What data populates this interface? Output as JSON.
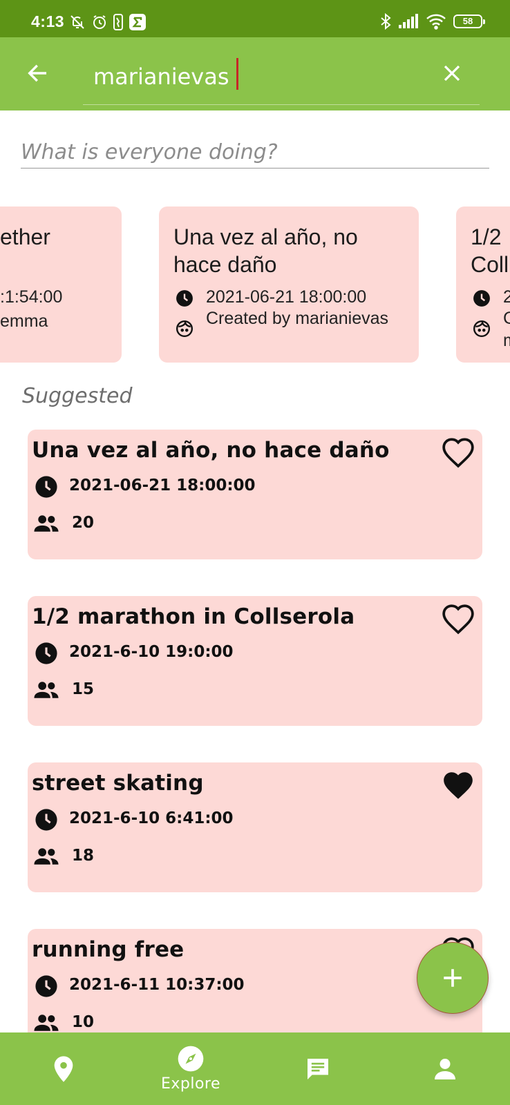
{
  "status_bar": {
    "time": "4:13",
    "battery_level": "58",
    "left_icons": [
      "mute-icon",
      "alarm-icon",
      "nba-icon",
      "sigma-icon"
    ],
    "right_icons": [
      "bluetooth-icon",
      "signal-icon",
      "wifi-icon",
      "battery-icon"
    ]
  },
  "app_bar": {
    "search_value": "marianievas",
    "back_icon": "back-arrow-icon",
    "clear_icon": "close-icon",
    "color": "#8bc34a"
  },
  "activity_search": {
    "placeholder": "What is everyone doing?"
  },
  "carousel": {
    "cards": [
      {
        "title": "ether",
        "time": ":1:54:00",
        "creator": "emma"
      },
      {
        "title": "Una vez al año, no hace daño",
        "time": "2021-06-21 18:00:00",
        "creator": "Created by marianievas"
      },
      {
        "title": "1/2 Coll",
        "time": "2",
        "creator": "C m"
      }
    ]
  },
  "suggested": {
    "label": "Suggested",
    "items": [
      {
        "title": "Una vez al año, no hace daño",
        "time": "2021-06-21 18:00:00",
        "participants": "20",
        "favorite": false
      },
      {
        "title": "1/2 marathon in Collserola",
        "time": "2021-6-10 19:0:00",
        "participants": "15",
        "favorite": false
      },
      {
        "title": "street skating",
        "time": "2021-6-10 6:41:00",
        "participants": "18",
        "favorite": true
      },
      {
        "title": "running free",
        "time": "2021-6-11 10:37:00",
        "participants": "10",
        "favorite": false
      }
    ]
  },
  "fab": {
    "icon": "plus-icon"
  },
  "bottom_nav": {
    "items": [
      {
        "icon": "map-pin-icon",
        "label": ""
      },
      {
        "icon": "compass-icon",
        "label": "Explore"
      },
      {
        "icon": "chat-icon",
        "label": ""
      },
      {
        "icon": "person-icon",
        "label": ""
      }
    ]
  },
  "colors": {
    "status_bar": "#5d9416",
    "primary": "#8bc34a",
    "card": "#fdd9d6"
  }
}
